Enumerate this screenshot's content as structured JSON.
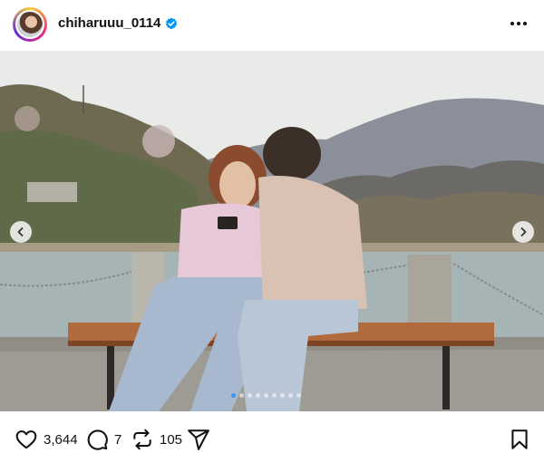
{
  "post": {
    "username": "chiharuuu_0114",
    "verified": true
  },
  "carousel": {
    "slide_count": 9,
    "active_index": 0
  },
  "actions": {
    "likes": "3,644",
    "comments": "7",
    "reposts": "105"
  },
  "colors": {
    "verified_blue": "#0095f6",
    "active_dot": "#3897f0"
  },
  "icons": {
    "like": "heart-icon",
    "comment": "comment-icon",
    "repost": "repost-icon",
    "share": "share-icon",
    "save": "bookmark-icon",
    "more": "more-icon"
  }
}
